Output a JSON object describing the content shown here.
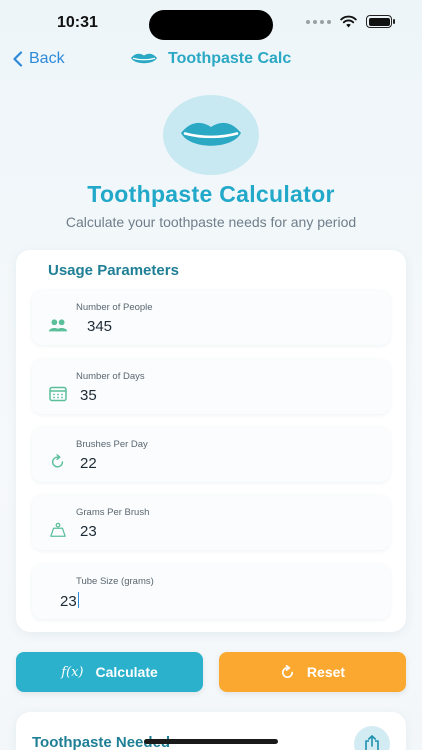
{
  "status_bar": {
    "time": "10:31"
  },
  "nav": {
    "back_label": "Back",
    "title": "Toothpaste Calc"
  },
  "hero": {
    "title": "Toothpaste Calculator",
    "subtitle": "Calculate your toothpaste needs for any period"
  },
  "params": {
    "title": "Usage Parameters",
    "fields": [
      {
        "label": "Number of People",
        "value": "345",
        "icon": "people-icon"
      },
      {
        "label": "Number of Days",
        "value": "35",
        "icon": "calendar-icon"
      },
      {
        "label": "Brushes Per Day",
        "value": "22",
        "icon": "refresh-icon"
      },
      {
        "label": "Grams Per Brush",
        "value": "23",
        "icon": "weight-icon"
      },
      {
        "label": "Tube Size (grams)",
        "value": "23",
        "icon": "none"
      }
    ]
  },
  "actions": {
    "calculate_label": "Calculate",
    "calculate_icon_text": "f(x)",
    "reset_label": "Reset"
  },
  "result": {
    "title": "Toothpaste Needed"
  },
  "colors": {
    "accent": "#22a8c8",
    "link": "#2d8ad8",
    "calculate": "#2bb1cc",
    "reset": "#fba830",
    "section_title": "#1f7f95"
  }
}
